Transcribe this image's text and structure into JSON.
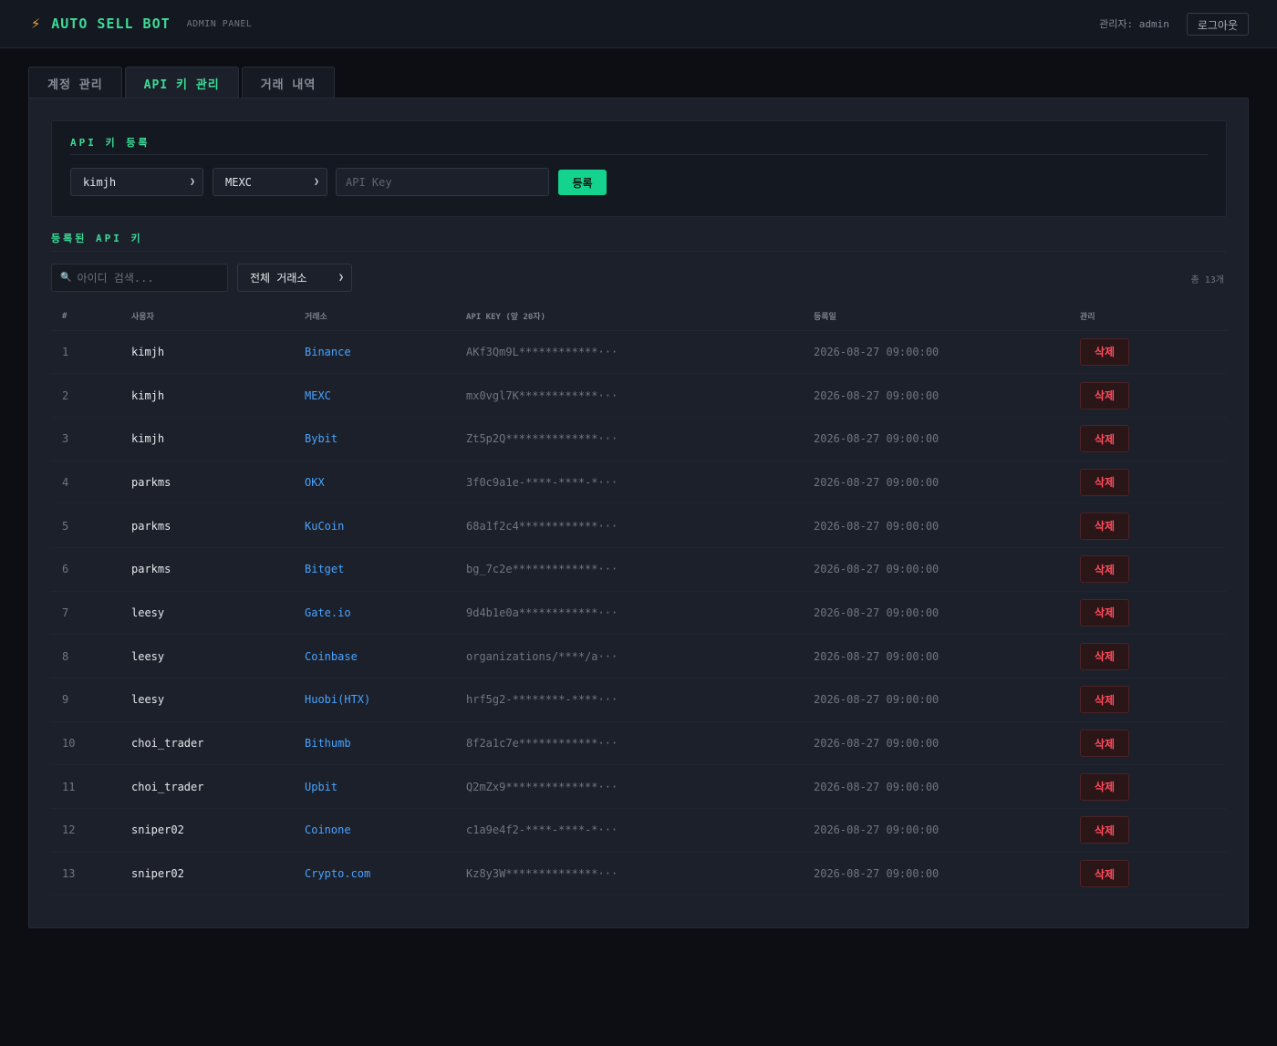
{
  "header": {
    "icon": "lightning-icon",
    "title": "AUTO SELL BOT",
    "subtitle": "ADMIN PANEL",
    "admin_label": "관리자: admin",
    "logout_label": "로그아웃"
  },
  "tabs": [
    {
      "label": "계정 관리",
      "active": false
    },
    {
      "label": "API 키 관리",
      "active": true
    },
    {
      "label": "거래 내역",
      "active": false
    }
  ],
  "register": {
    "title": "API 키 등록",
    "user_select": "kimjh",
    "exchange_select": "MEXC",
    "api_key_placeholder": "API Key",
    "submit_label": "등록"
  },
  "list": {
    "title": "등록된 API 키",
    "search_placeholder": "아이디 검색...",
    "exchange_filter": "전체 거래소",
    "total": "총 13개",
    "columns": [
      "#",
      "사용자",
      "거래소",
      "API KEY (앞 20자)",
      "등록일",
      "관리"
    ],
    "delete_label": "삭제",
    "rows": [
      {
        "num": "1",
        "user": "kimjh",
        "exchange": "Binance",
        "key": "AKf3Qm9L************···",
        "date": "2026-08-27 09:00:00"
      },
      {
        "num": "2",
        "user": "kimjh",
        "exchange": "MEXC",
        "key": "mx0vgl7K************···",
        "date": "2026-08-27 09:00:00"
      },
      {
        "num": "3",
        "user": "kimjh",
        "exchange": "Bybit",
        "key": "Zt5p2Q**************···",
        "date": "2026-08-27 09:00:00"
      },
      {
        "num": "4",
        "user": "parkms",
        "exchange": "OKX",
        "key": "3f0c9a1e-****-****-*···",
        "date": "2026-08-27 09:00:00"
      },
      {
        "num": "5",
        "user": "parkms",
        "exchange": "KuCoin",
        "key": "68a1f2c4************···",
        "date": "2026-08-27 09:00:00"
      },
      {
        "num": "6",
        "user": "parkms",
        "exchange": "Bitget",
        "key": "bg_7c2e*************···",
        "date": "2026-08-27 09:00:00"
      },
      {
        "num": "7",
        "user": "leesy",
        "exchange": "Gate.io",
        "key": "9d4b1e0a************···",
        "date": "2026-08-27 09:00:00"
      },
      {
        "num": "8",
        "user": "leesy",
        "exchange": "Coinbase",
        "key": "organizations/****/a···",
        "date": "2026-08-27 09:00:00"
      },
      {
        "num": "9",
        "user": "leesy",
        "exchange": "Huobi(HTX)",
        "key": "hrf5g2-********-****···",
        "date": "2026-08-27 09:00:00"
      },
      {
        "num": "10",
        "user": "choi_trader",
        "exchange": "Bithumb",
        "key": "8f2a1c7e************···",
        "date": "2026-08-27 09:00:00"
      },
      {
        "num": "11",
        "user": "choi_trader",
        "exchange": "Upbit",
        "key": "Q2mZx9**************···",
        "date": "2026-08-27 09:00:00"
      },
      {
        "num": "12",
        "user": "sniper02",
        "exchange": "Coinone",
        "key": "c1a9e4f2-****-****-*···",
        "date": "2026-08-27 09:00:00"
      },
      {
        "num": "13",
        "user": "sniper02",
        "exchange": "Crypto.com",
        "key": "Kz8y3W**************···",
        "date": "2026-08-27 09:00:00"
      }
    ]
  }
}
